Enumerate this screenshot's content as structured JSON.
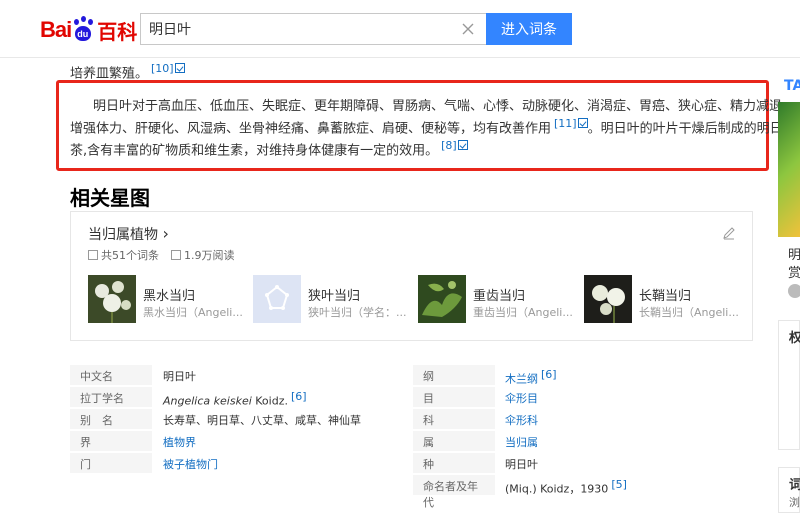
{
  "header": {
    "logo_bai": "Bai",
    "logo_du": "du",
    "logo_baike": "百科",
    "search_value": "明日叶",
    "search_button": "进入词条"
  },
  "article": {
    "prev_line": "培养皿繁殖。",
    "prev_ref": "[10]",
    "para_line1": "明日叶对于高血压、低血压、失眠症、更年期障碍、胃肠病、气喘、心悸、动脉硬化、消渴症、胃癌、狭心症、精力减退、",
    "para_line2": "增强体力、肝硬化、风湿病、坐骨神经痛、鼻蓄脓症、肩硬、便秘等，均有改善作用",
    "para_ref1": "[11]",
    "para_line2b": "。明日叶的叶片干燥后制成的明日叶",
    "para_line3": "茶,含有丰富的矿物质和维生素，对维持身体健康有一定的效用。",
    "para_ref2": "[8]"
  },
  "star_map": {
    "section_title": "相关星图",
    "card_title": "当归属植物",
    "chevron": "›",
    "count": "共51个词条",
    "reads": "1.9万阅读",
    "plants": [
      {
        "name": "黑水当归",
        "sub": "黑水当归（Angeli..."
      },
      {
        "name": "狭叶当归",
        "sub": "狭叶当归（学名：..."
      },
      {
        "name": "重齿当归",
        "sub": "重齿当归（Angeli..."
      },
      {
        "name": "长鞘当归",
        "sub": "长鞘当归（Angeli..."
      }
    ]
  },
  "info": {
    "left": [
      {
        "k": "中文名",
        "v": "明日叶"
      },
      {
        "k": "拉丁学名",
        "v_italic": "Angelica keiskei",
        "v": " Koidz.",
        "ref": "[6]"
      },
      {
        "k": "别　名",
        "v": "长寿草、明日草、八丈草、咸草、神仙草"
      },
      {
        "k": "界",
        "v": "植物界"
      },
      {
        "k": "门",
        "v": "被子植物门"
      }
    ],
    "right": [
      {
        "k": "纲",
        "v": "木兰纲",
        "ref": "[6]"
      },
      {
        "k": "目",
        "v": "伞形目"
      },
      {
        "k": "科",
        "v": "伞形科"
      },
      {
        "k": "属",
        "v": "当归属"
      },
      {
        "k": "种",
        "v": "明日叶"
      },
      {
        "k": "命名者及年代",
        "v": "(Miq.) Koidz，1930",
        "ref": "[5]"
      }
    ]
  },
  "right_rail": {
    "t1": "TA",
    "t2": "明",
    "t3": "赏",
    "t4": "权",
    "t5": "词",
    "t6": "浏"
  }
}
